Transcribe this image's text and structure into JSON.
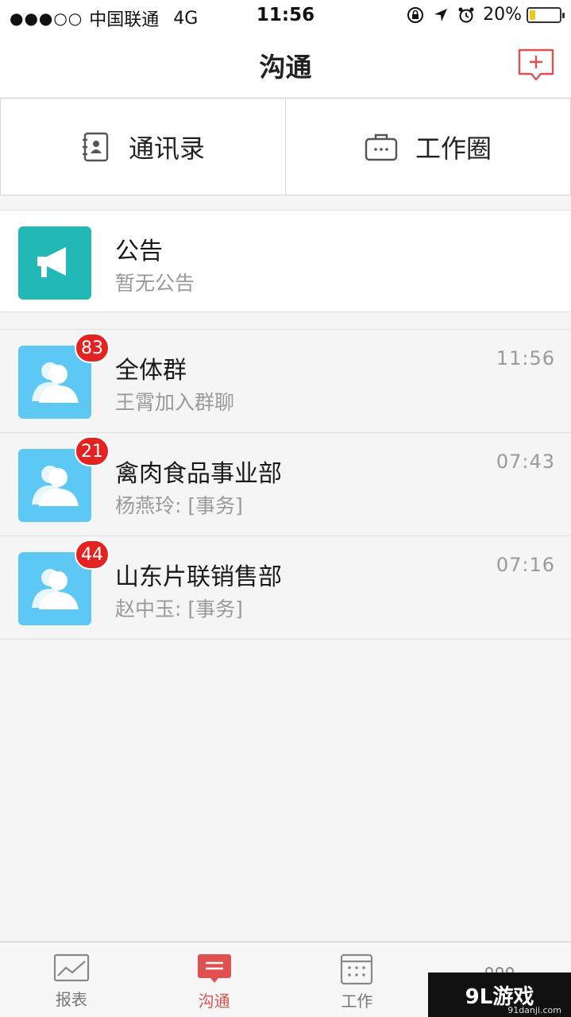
{
  "status_bar": {
    "signal": "●●●○○",
    "carrier": "中国联通",
    "network": "4G",
    "time": "11:56",
    "battery_text": "20%",
    "battery_level": 0.2,
    "icons": [
      "orientation-lock-icon",
      "location-icon",
      "alarm-icon"
    ]
  },
  "nav": {
    "title": "沟通",
    "new_chat_icon": "add-message-icon"
  },
  "quick_tabs": [
    {
      "label": "通讯录",
      "icon": "contacts-icon"
    },
    {
      "label": "工作圈",
      "icon": "briefcase-icon"
    }
  ],
  "announcement": {
    "title": "公告",
    "subtitle": "暂无公告",
    "icon": "megaphone-icon"
  },
  "chats": [
    {
      "name": "全体群",
      "preview": "王霄加入群聊",
      "time": "11:56",
      "badge": "83"
    },
    {
      "name": "禽肉食品事业部",
      "preview": "杨燕玲: [事务]",
      "time": "07:43",
      "badge": "21"
    },
    {
      "name": "山东片联销售部",
      "preview": "赵中玉: [事务]",
      "time": "07:16",
      "badge": "44"
    }
  ],
  "tab_bar": [
    {
      "label": "报表",
      "icon": "chart-icon",
      "active": false
    },
    {
      "label": "沟通",
      "icon": "chat-icon",
      "active": true
    },
    {
      "label": "工作",
      "icon": "grid-calendar-icon",
      "active": false
    },
    {
      "label": "",
      "icon": "more-icon",
      "active": false
    }
  ],
  "watermark": {
    "main": "9L游戏",
    "sub": "91danji.com"
  },
  "colors": {
    "accent": "#e0504e",
    "teal": "#22b8b6",
    "avatar_blue": "#5ec8f5",
    "badge_red": "#e32222"
  }
}
